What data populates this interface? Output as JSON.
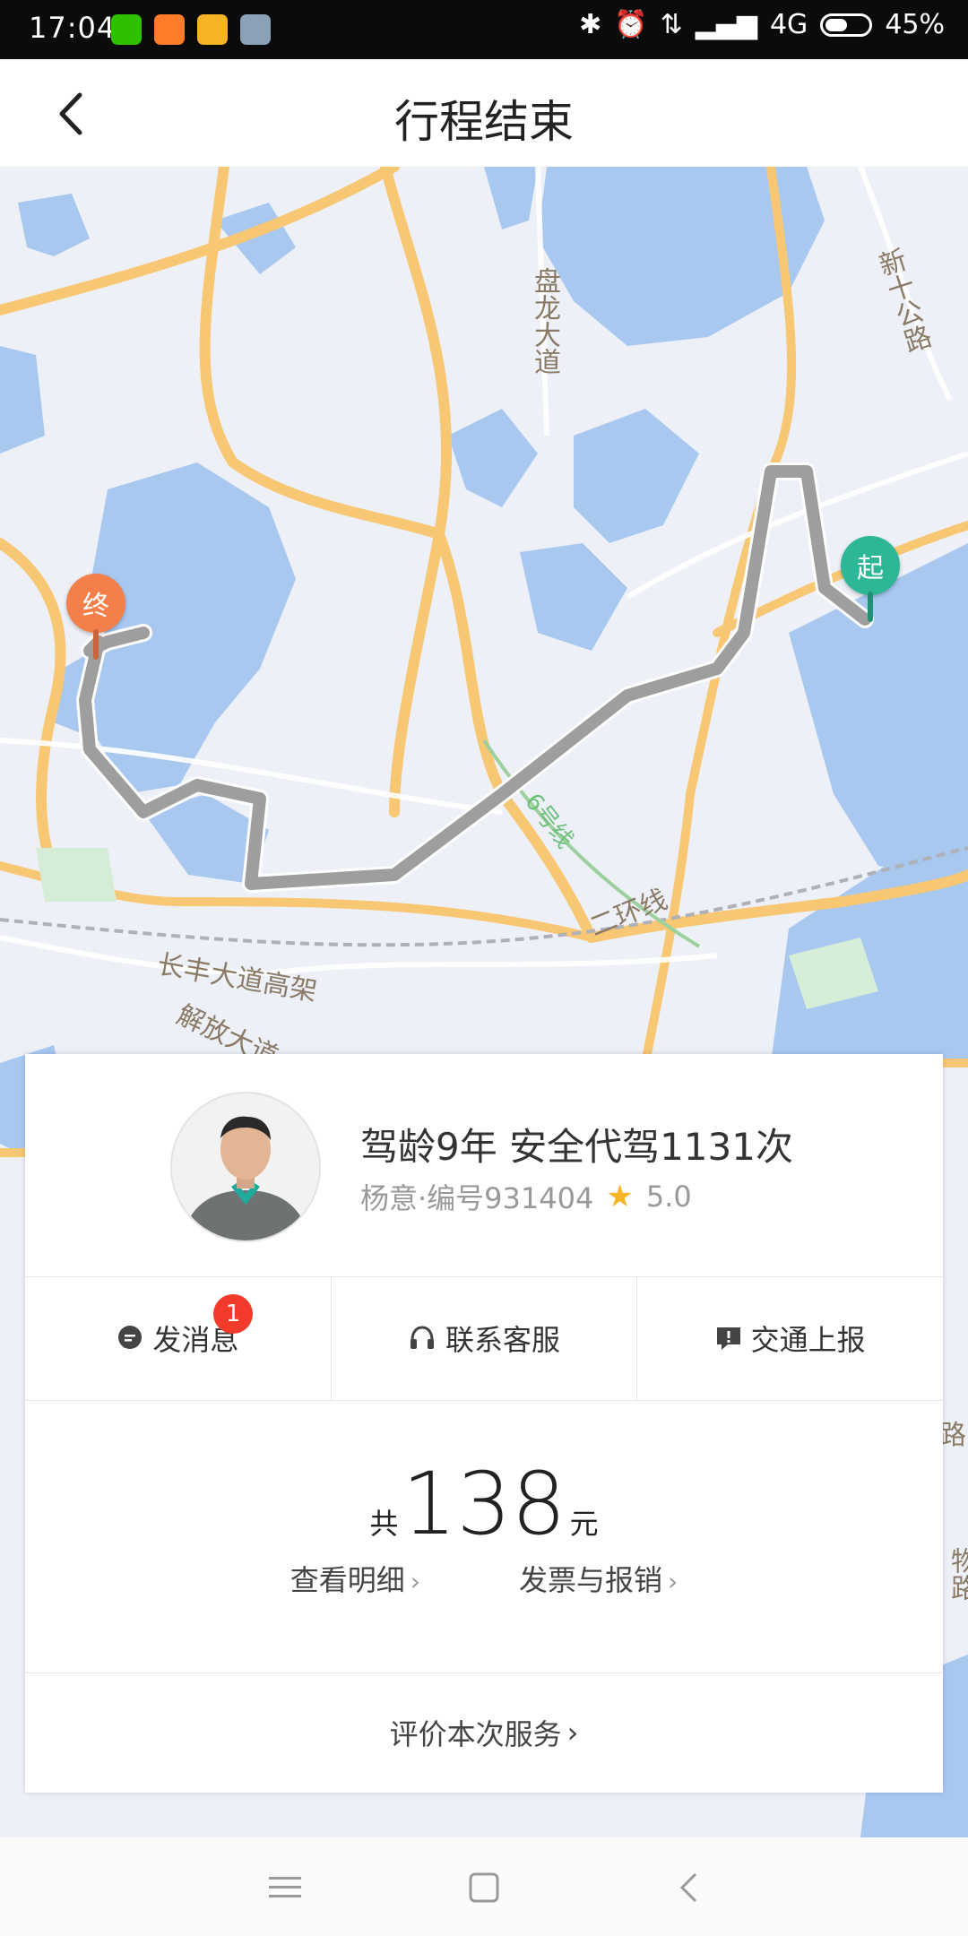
{
  "status": {
    "time": "17:04",
    "network": "4G",
    "battery": "45%",
    "battery_level": 0.45
  },
  "header": {
    "title": "行程结束",
    "back_icon": "chevron-left-icon"
  },
  "map": {
    "labels": {
      "panlong": "盘龙大道",
      "xinshi": "新十公路",
      "line6": "6号线",
      "erhuan": "二环线",
      "changfeng": "长丰大道高架",
      "jiefang": "解放大道",
      "lu": "路",
      "wu": "物",
      "lu2": "路"
    },
    "pins": {
      "end": "终",
      "start": "起"
    },
    "colors": {
      "route": "#9e9e9e",
      "start_pin": "#2db797",
      "end_pin": "#f37f4a",
      "water": "#a8c8f0",
      "road": "#f8c774"
    }
  },
  "driver": {
    "headline": "驾龄9年  安全代驾1131次",
    "subline": "杨意·编号931404",
    "rating": "5.0",
    "star_icon": "star-icon"
  },
  "actions": [
    {
      "label": "发消息",
      "icon": "message-icon",
      "badge": "1"
    },
    {
      "label": "联系客服",
      "icon": "headset-icon"
    },
    {
      "label": "交通上报",
      "icon": "report-icon"
    }
  ],
  "price": {
    "prefix": "共",
    "amount": "138",
    "unit": "元",
    "detail_link": "查看明细",
    "invoice_link": "发票与报销"
  },
  "rate_link": "评价本次服务"
}
